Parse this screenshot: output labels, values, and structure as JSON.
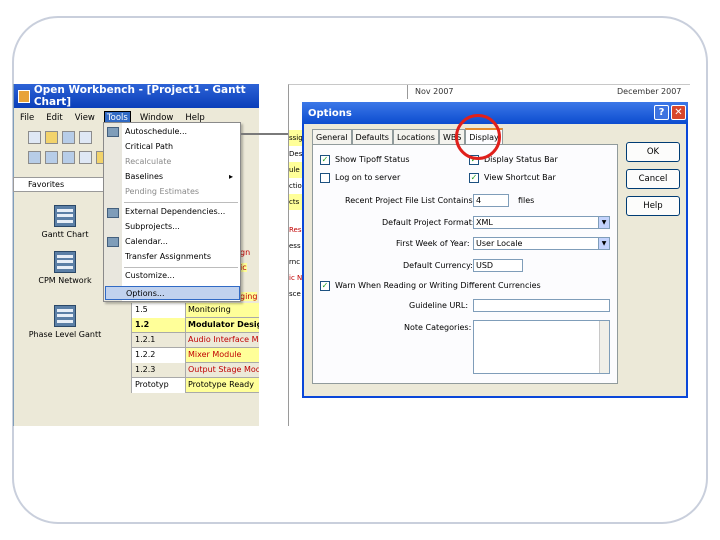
{
  "workbench": {
    "title": "Open Workbench - [Project1 - Gantt Chart]",
    "menu": [
      "File",
      "Edit",
      "View",
      "Tools",
      "Window",
      "Help"
    ],
    "active_menu": "Tools",
    "left_panel": {
      "header": "Favorites",
      "views": [
        "Gantt Chart",
        "CPM Network",
        "Phase Level Gantt"
      ]
    },
    "tools_menu": [
      {
        "label": "Autoschedule...",
        "disabled": false
      },
      {
        "label": "Critical Path",
        "disabled": false
      },
      {
        "label": "Recalculate",
        "disabled": true
      },
      {
        "label": "Baselines",
        "disabled": false,
        "submenu": true
      },
      {
        "label": "Pending Estimates",
        "disabled": true
      },
      {
        "label": "External Dependencies...",
        "disabled": false
      },
      {
        "label": "Subprojects...",
        "disabled": false
      },
      {
        "label": "Calendar...",
        "disabled": false
      },
      {
        "label": "Transfer Assignments",
        "disabled": false
      },
      {
        "label": "Customize...",
        "disabled": false
      },
      {
        "label": "Options...",
        "disabled": false,
        "highlighted": true
      }
    ],
    "grid_rows": [
      {
        "id": "1.5",
        "name": "Monitoring",
        "style": "yellow"
      },
      {
        "id": "1.2",
        "name": "Modulator Design",
        "style": "bold-yellow"
      },
      {
        "id": "1.2.1",
        "name": "Audio Interface Mod",
        "style": "red"
      },
      {
        "id": "1.2.2",
        "name": "Mixer Module",
        "style": "red-yellow"
      },
      {
        "id": "1.2.3",
        "name": "Output Stage Modu",
        "style": "red"
      },
      {
        "id": "Prototyp",
        "name": "Prototype Ready",
        "style": "yellow"
      }
    ],
    "menu_partial_words": [
      "gn",
      "ic",
      "ging"
    ]
  },
  "gantt": {
    "months": [
      "Nov 2007",
      "December 2007"
    ],
    "left_fragments": [
      "ssign",
      "Des",
      "ule",
      "ction",
      "cts",
      "Res",
      "ess",
      "rnc",
      "ic N",
      "sce"
    ]
  },
  "options_dialog": {
    "title": "Options",
    "help_glyph": "?",
    "close_glyph": "✕",
    "tabs": [
      "General",
      "Defaults",
      "Locations",
      "WBS",
      "Display"
    ],
    "active_tab": "Display",
    "checkboxes": [
      {
        "label": "Show Tipoff Status",
        "checked": true
      },
      {
        "label": "Display Status Bar",
        "checked": true
      },
      {
        "label": "Log on to server",
        "checked": false
      },
      {
        "label": "View Shortcut Bar",
        "checked": true
      }
    ],
    "recent_files": {
      "label": "Recent Project File List Contains:",
      "value": "4",
      "unit": "files"
    },
    "default_format": {
      "label": "Default Project Format:",
      "value": "XML"
    },
    "first_week": {
      "label": "First Week of Year:",
      "value": "User Locale"
    },
    "currency": {
      "label": "Default Currency:",
      "value": "USD"
    },
    "warn": {
      "label": "Warn When Reading or Writing Different Currencies",
      "checked": true
    },
    "guideline_url": {
      "label": "Guideline URL:",
      "value": ""
    },
    "note_categories": {
      "label": "Note Categories:"
    },
    "buttons": {
      "ok": "OK",
      "cancel": "Cancel",
      "help": "Help"
    }
  },
  "colors": {
    "highlight_circle": "#e0201b",
    "title_bar": "#0c4ccf",
    "grid_yellow": "#ffff99"
  }
}
